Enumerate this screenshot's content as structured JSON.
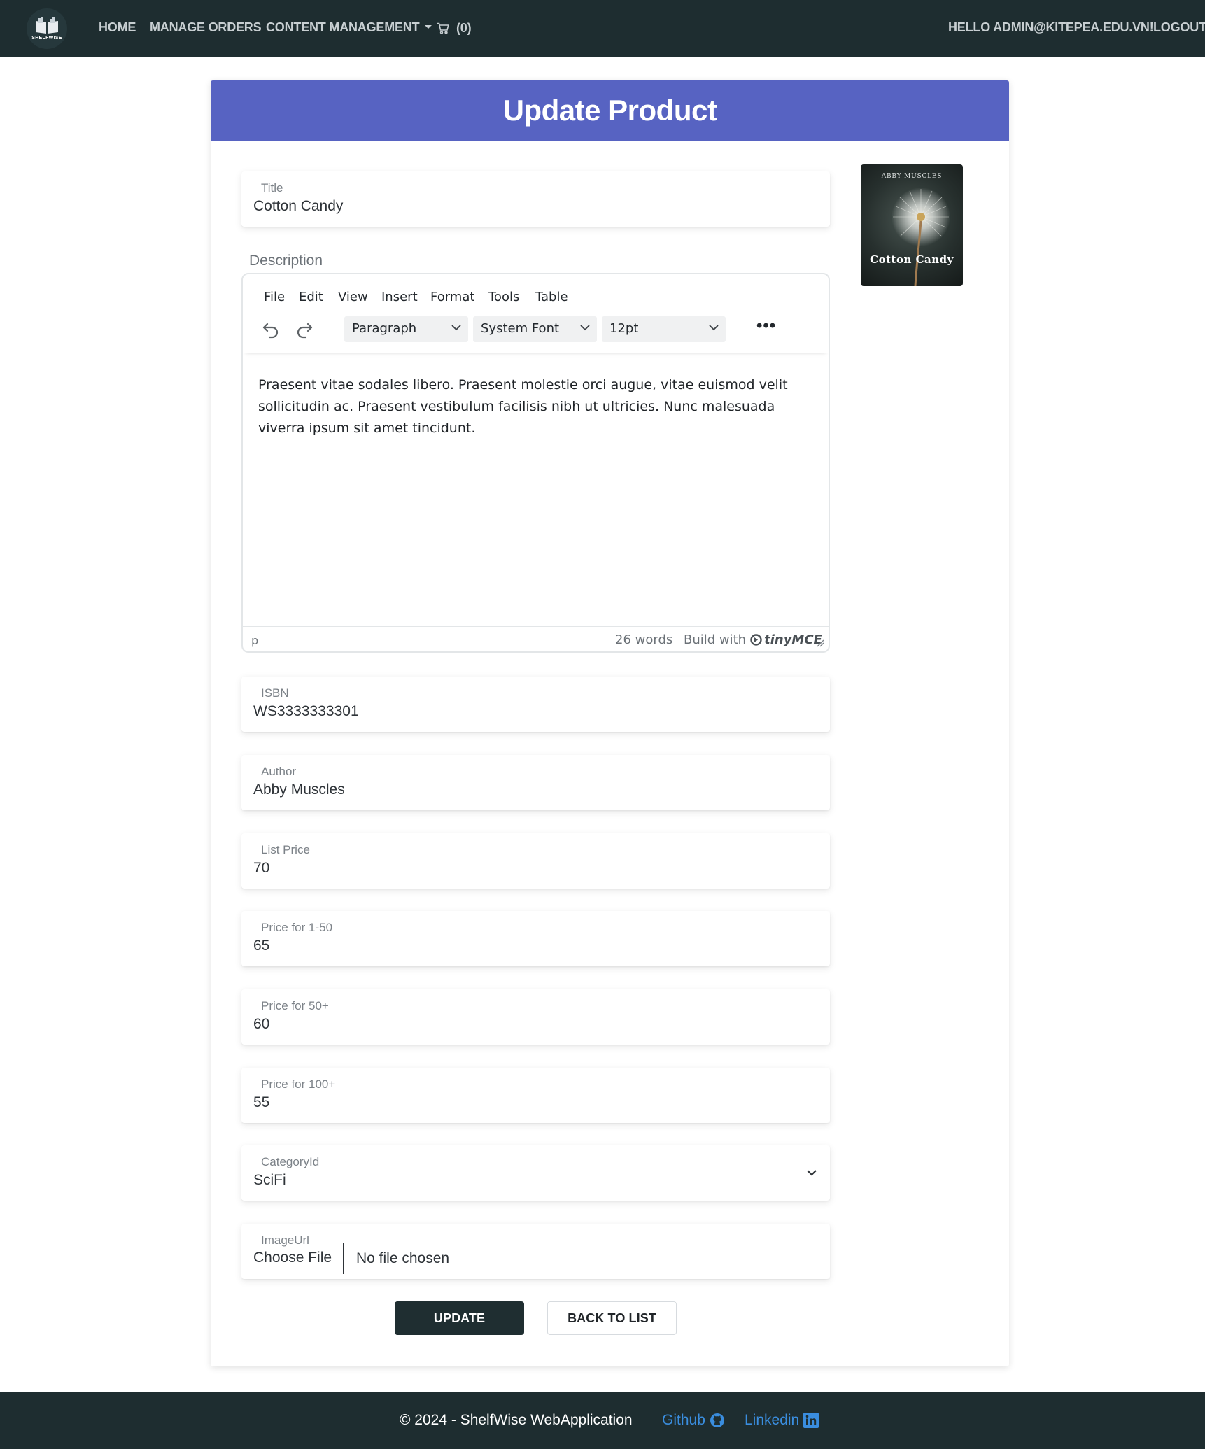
{
  "nav": {
    "logo_text": "SHELFWISE",
    "links": [
      "HOME",
      "MANAGE ORDERS",
      "CONTENT MANAGEMENT"
    ],
    "cart_count": "(0)",
    "greeting": "HELLO ADMIN@KITEPEA.EDU.VN!",
    "logout": "LOGOUT"
  },
  "page": {
    "title": "Update Product"
  },
  "form": {
    "title": {
      "label": "Title",
      "value": "Cotton Candy"
    },
    "description": {
      "label": "Description",
      "menu": [
        "File",
        "Edit",
        "View",
        "Insert",
        "Format",
        "Tools",
        "Table"
      ],
      "block_format": "Paragraph",
      "font_family": "System Font",
      "font_size": "12pt",
      "content": "Praesent vitae sodales libero. Praesent molestie orci augue, vitae euismod velit sollicitudin ac. Praesent vestibulum facilisis nibh ut ultricies. Nunc malesuada viverra ipsum sit amet tincidunt.",
      "status_path": "p",
      "word_count": "26 words",
      "build_with": "Build with",
      "brand": "tinyMCE"
    },
    "isbn": {
      "label": "ISBN",
      "value": "WS3333333301"
    },
    "author": {
      "label": "Author",
      "value": "Abby Muscles"
    },
    "list_price": {
      "label": "List Price",
      "value": "70"
    },
    "price_1_50": {
      "label": "Price for 1-50",
      "value": "65"
    },
    "price_50": {
      "label": "Price for 50+",
      "value": "60"
    },
    "price_100": {
      "label": "Price for 100+",
      "value": "55"
    },
    "category": {
      "label": "CategoryId",
      "value": "SciFi"
    },
    "image": {
      "label": "ImageUrl",
      "button": "Choose File",
      "status": "No file chosen"
    }
  },
  "cover": {
    "author": "ABBY MUSCLES",
    "title": "Cotton Candy"
  },
  "buttons": {
    "update": "UPDATE",
    "back": "BACK TO LIST"
  },
  "footer": {
    "copyright": "© 2024 - ShelfWise WebApplication",
    "github": "Github",
    "linkedin": "Linkedin"
  },
  "colors": {
    "navbar": "#1e2d30",
    "header": "#5763c2",
    "link": "#3a8dde"
  }
}
